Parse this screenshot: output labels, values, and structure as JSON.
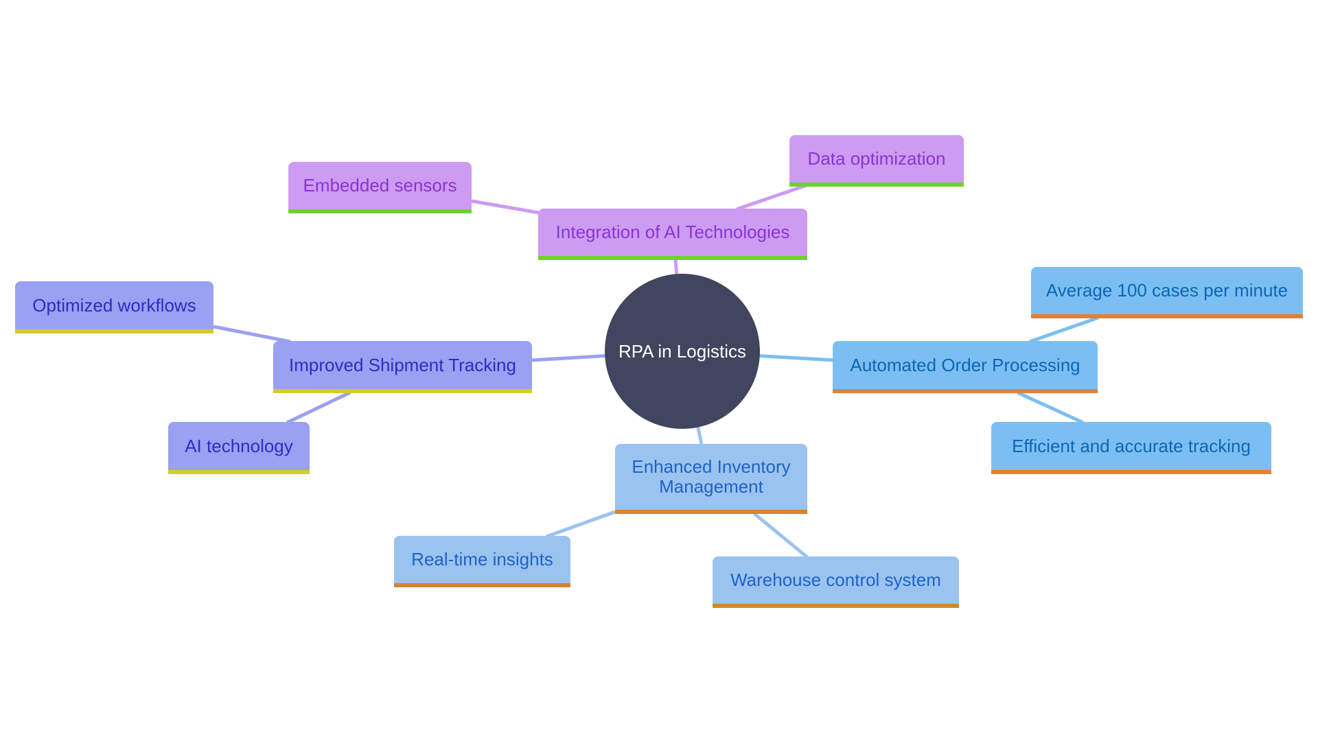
{
  "diagram": {
    "type": "mindmap",
    "root": {
      "label": "RPA in Logistics",
      "color": "#41455e"
    },
    "branches": [
      {
        "label": "Integration of AI Technologies",
        "colors": {
          "fill": "#cd9bf1",
          "text": "#8a35d3",
          "accent": "#6fd22a"
        },
        "children": [
          "Embedded sensors",
          "Data optimization"
        ]
      },
      {
        "label": "Improved Shipment Tracking",
        "colors": {
          "fill": "#9aa0f2",
          "text": "#2c2dc4",
          "accent": "#d4cc2a"
        },
        "children": [
          "Optimized workflows",
          "AI technology"
        ]
      },
      {
        "label": "Automated Order Processing",
        "colors": {
          "fill": "#7bbff2",
          "text": "#0e65b8",
          "accent": "#e57f35"
        },
        "children": [
          "Average 100 cases per minute",
          "Efficient and accurate tracking"
        ]
      },
      {
        "label": "Enhanced Inventory Management",
        "colors": {
          "fill": "#9bc3f0",
          "text": "#1f63c6",
          "accent": "#d4852d"
        },
        "children": [
          "Real-time insights",
          "Warehouse control system"
        ]
      }
    ]
  }
}
